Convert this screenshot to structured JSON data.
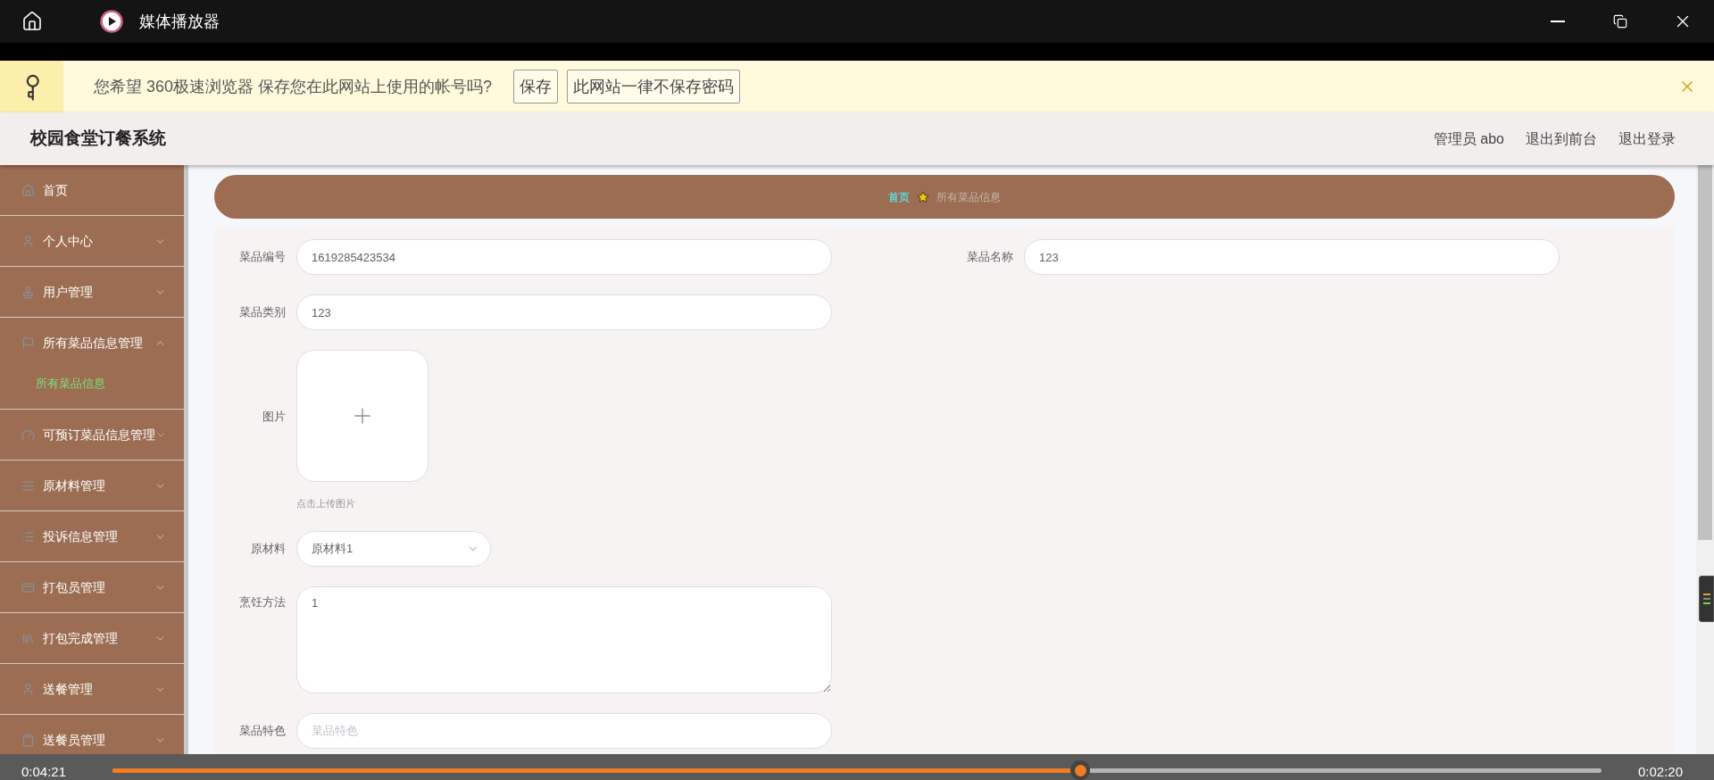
{
  "window": {
    "title": "媒体播放器"
  },
  "password_bar": {
    "message": "您希望 360极速浏览器 保存您在此网站上使用的帐号吗?",
    "buttons": [
      "保存",
      "此网站一律不保存密码"
    ]
  },
  "header": {
    "title": "校园食堂订餐系统",
    "links": [
      "管理员 abo",
      "退出到前台",
      "退出登录"
    ]
  },
  "sidebar": {
    "items": [
      {
        "label": "首页"
      },
      {
        "label": "个人中心",
        "expanded": false
      },
      {
        "label": "用户管理",
        "expanded": false
      },
      {
        "label": "所有菜品信息管理",
        "expanded": true,
        "children": [
          {
            "label": "所有菜品信息",
            "selected": true
          }
        ]
      },
      {
        "label": "可预订菜品信息管理",
        "expanded": false
      },
      {
        "label": "原材料管理",
        "expanded": false
      },
      {
        "label": "投诉信息管理",
        "expanded": false
      },
      {
        "label": "打包员管理",
        "expanded": false
      },
      {
        "label": "打包完成管理",
        "expanded": false
      },
      {
        "label": "送餐管理",
        "expanded": false
      },
      {
        "label": "送餐员管理",
        "expanded": false
      }
    ]
  },
  "breadcrumb": [
    "首页",
    "所有菜品信息"
  ],
  "form": {
    "rows": [
      [
        {
          "label": "菜品编号",
          "kind": "text",
          "value": "1619285423534"
        },
        {
          "label": "菜品名称",
          "kind": "text",
          "value": "123"
        }
      ],
      [
        {
          "label": "菜品类别",
          "kind": "text",
          "value": "123"
        }
      ],
      [
        {
          "label": "图片",
          "kind": "upload",
          "hint": "点击上传图片"
        }
      ],
      [
        {
          "label": "原材料",
          "kind": "select",
          "value": "原材料1"
        }
      ],
      [
        {
          "label": "烹饪方法",
          "kind": "textarea",
          "value": "1"
        }
      ],
      [
        {
          "label": "菜品特色",
          "kind": "text",
          "placeholder": "菜品特色"
        }
      ]
    ]
  },
  "player": {
    "elapsed": "0:04:21",
    "remaining": "0:02:20",
    "level": 0.65
  }
}
